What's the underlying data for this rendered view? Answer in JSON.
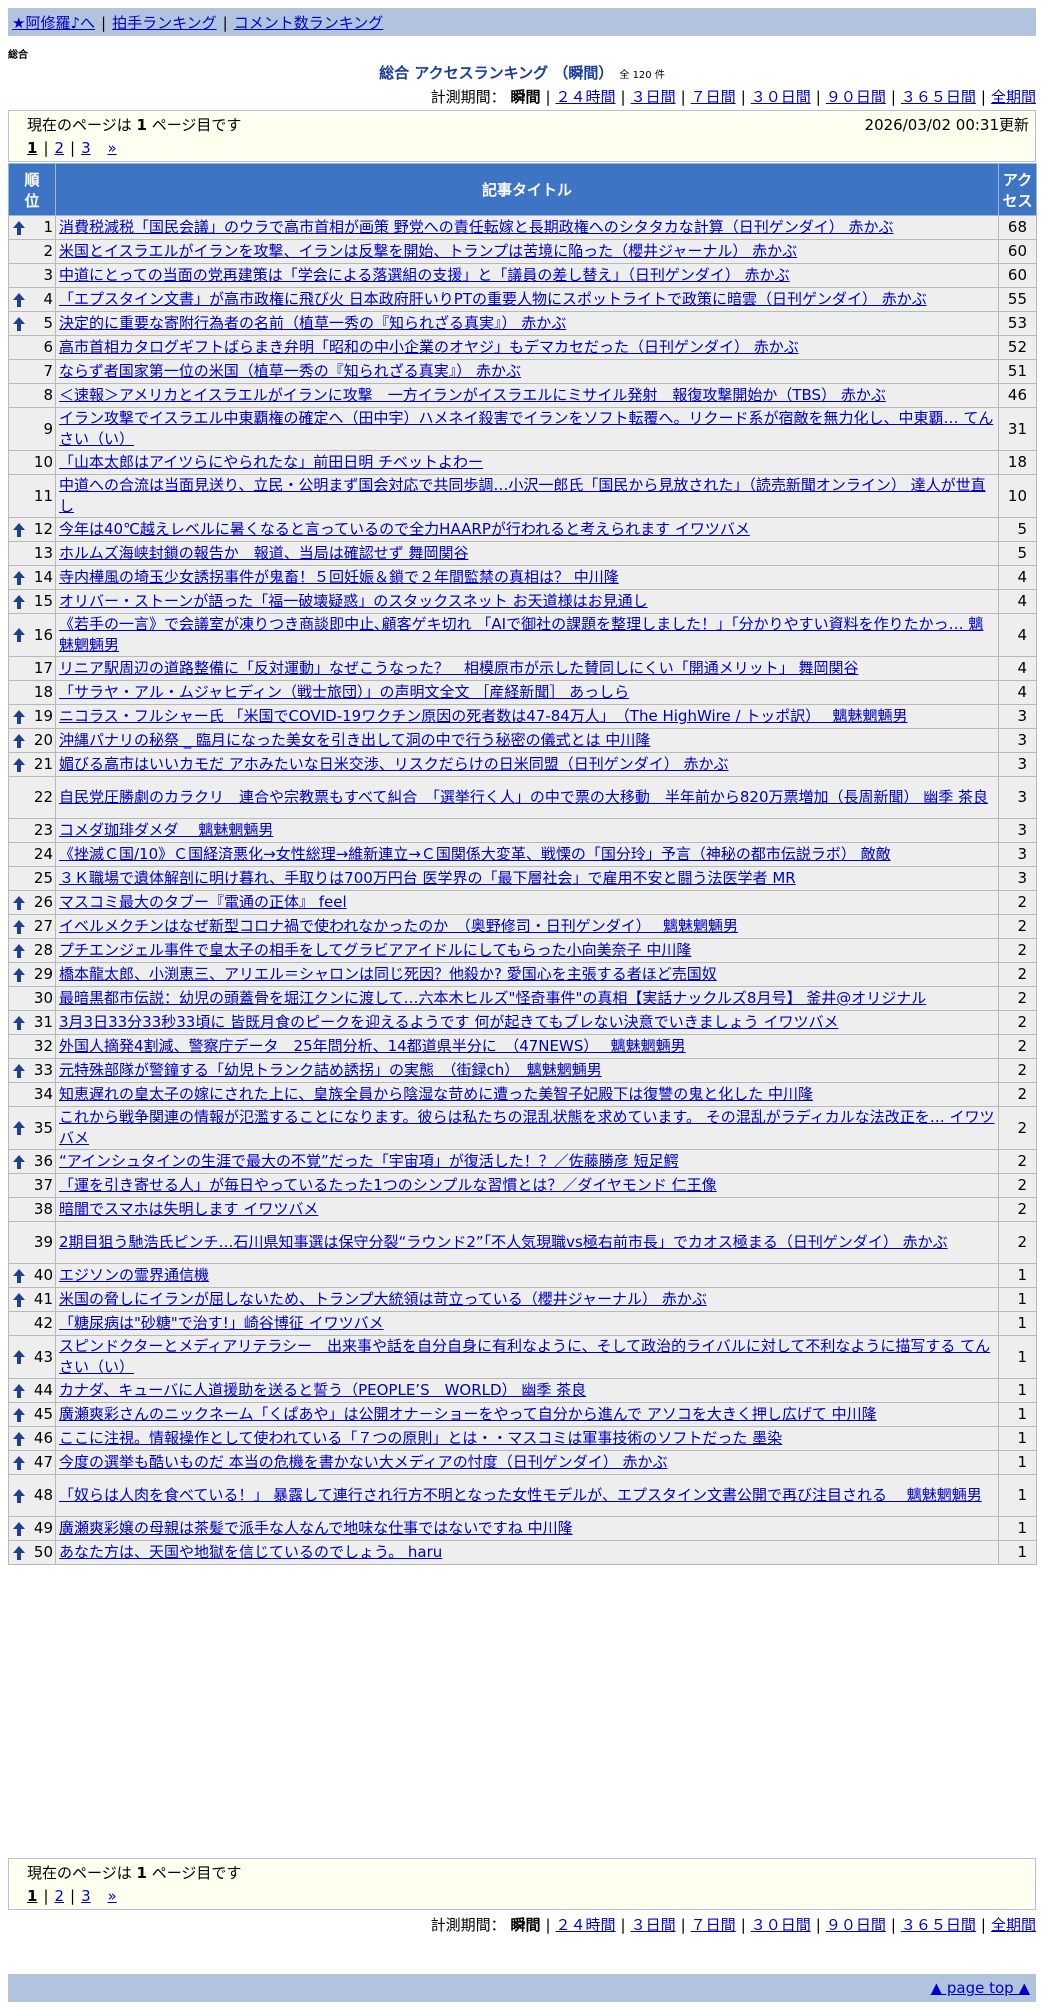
{
  "topnav": {
    "items": [
      "★阿修羅♪へ",
      "拍手ランキング",
      "コメント数ランキング"
    ]
  },
  "section_label": "総合",
  "title": "総合 アクセスランキング （瞬間）",
  "total_count": "全 120 件",
  "period": {
    "label": "計測期間：",
    "current": "瞬間",
    "links": [
      "２４時間",
      "３日間",
      "７日間",
      "３０日間",
      "９０日間",
      "３６５日間",
      "全期間"
    ]
  },
  "pageinfo": {
    "text_before": "現在のページは ",
    "current": "1",
    "text_after": " ページ目です",
    "updated": "2026/03/02 00:31更新",
    "pages": [
      "1",
      "2",
      "3",
      "»"
    ]
  },
  "table": {
    "col_rank": [
      "順",
      "位"
    ],
    "col_title": "記事タイトル",
    "col_access": [
      "アク",
      "セス"
    ],
    "rows": [
      {
        "rank": "1",
        "up": true,
        "title": "消費税減税「国民会議」のウラで高市首相が画策 野党への責任転嫁と長期政権へのシタタカな計算（日刊ゲンダイ） 赤かぶ",
        "access": "68"
      },
      {
        "rank": "2",
        "up": false,
        "title": "米国とイスラエルがイランを攻撃、イランは反撃を開始、トランプは苦境に陥った（櫻井ジャーナル） 赤かぶ",
        "access": "60"
      },
      {
        "rank": "3",
        "up": false,
        "title": "中道にとっての当面の党再建策は「学会による落選組の支援」と「議員の差し替え」（日刊ゲンダイ） 赤かぶ",
        "access": "60"
      },
      {
        "rank": "4",
        "up": true,
        "title": "「エプスタイン文書」が高市政権に飛び火 日本政府肝いりPTの重要人物にスポットライトで政策に暗雲（日刊ゲンダイ） 赤かぶ",
        "access": "55"
      },
      {
        "rank": "5",
        "up": true,
        "title": "決定的に重要な寄附行為者の名前（植草一秀の『知られざる真実』） 赤かぶ",
        "access": "53"
      },
      {
        "rank": "6",
        "up": false,
        "title": "高市首相カタログギフトばらまき弁明「昭和の中小企業のオヤジ」もデマカセだった（日刊ゲンダイ） 赤かぶ",
        "access": "52"
      },
      {
        "rank": "7",
        "up": false,
        "title": "ならず者国家第一位の米国（植草一秀の『知られざる真実』） 赤かぶ",
        "access": "51"
      },
      {
        "rank": "8",
        "up": false,
        "title": "＜速報＞アメリカとイスラエルがイランに攻撃　一方イランがイスラエルにミサイル発射　報復攻撃開始か（TBS） 赤かぶ",
        "access": "46"
      },
      {
        "rank": "9",
        "up": false,
        "title": "イラン攻撃でイスラエル中東覇権の確定へ（田中宇）ハメネイ殺害でイランをソフト転覆へ。リクード系が宿敵を無力化し、中東覇… てんさい（い）",
        "access": "31"
      },
      {
        "rank": "10",
        "up": false,
        "title": "「山本太郎はアイツらにやられたな」前田日明 チベットよわー",
        "access": "18"
      },
      {
        "rank": "11",
        "up": false,
        "title": "中道への合流は当面見送り、立民・公明まず国会対応で共同歩調…小沢一郎氏「国民から見放された」（読売新聞オンライン） 達人が世直し",
        "access": "10"
      },
      {
        "rank": "12",
        "up": true,
        "title": "今年は40℃越えレベルに暑くなると言っているので全力HAARPが行われると考えられます イワツバメ",
        "access": "5"
      },
      {
        "rank": "13",
        "up": false,
        "title": "ホルムズ海峡封鎖の報告か　報道、当局は確認せず 舞岡関谷",
        "access": "5"
      },
      {
        "rank": "14",
        "up": true,
        "title": "寺内樺風の埼玉少女誘拐事件が鬼畜！５回妊娠＆鎖で２年間監禁の真相は？ 中川隆",
        "access": "4"
      },
      {
        "rank": "15",
        "up": true,
        "title": "オリバー・ストーンが語った「福一破壊疑惑」のスタックスネット お天道様はお見通し",
        "access": "4"
      },
      {
        "rank": "16",
        "up": true,
        "title": "《若手の一言》で会議室が凍りつき商談即中止､顧客ゲキ切れ 「AIで御社の課題を整理しました！」「分かりやすい資料を作りたかっ… 魑魅魍魎男",
        "access": "4"
      },
      {
        "rank": "17",
        "up": false,
        "title": "リニア駅周辺の道路整備に「反対運動」なぜこうなった？　相模原市が示した賛同しにくい「開通メリット」 舞岡関谷",
        "access": "4"
      },
      {
        "rank": "18",
        "up": false,
        "title": "「サラヤ・アル・ムジャヒディン（戦士旅団）」の声明文全文 ［産経新聞］ あっしら",
        "access": "4"
      },
      {
        "rank": "19",
        "up": true,
        "title": "ニコラス・フルシャー氏 「米国でCOVID-19ワクチン原因の死者数は47-84万人」　（The HighWire / トッポ訳）　 魑魅魍魎男",
        "access": "3"
      },
      {
        "rank": "20",
        "up": true,
        "title": "沖縄パナリの秘祭 _ 臨月になった美女を引き出して洞の中で行う秘密の儀式とは 中川隆",
        "access": "3"
      },
      {
        "rank": "21",
        "up": true,
        "title": "媚びる高市はいいカモだ アホみたいな日米交渉、リスクだらけの日米同盟（日刊ゲンダイ） 赤かぶ",
        "access": "3"
      },
      {
        "rank": "22",
        "up": false,
        "title": "自民党圧勝劇のカラクリ　連合や宗教票もすべて糾合　「選挙行く人」の中で票の大移動　半年前から820万票増加（長周新聞） 幽季 茶良",
        "access": "3"
      },
      {
        "rank": "23",
        "up": false,
        "title": "コメダ珈琲ダメダ 　魑魅魍魎男",
        "access": "3"
      },
      {
        "rank": "24",
        "up": false,
        "title": "《挫滅Ｃ国/10》Ｃ国経済悪化→女性総理→維新連立→Ｃ国関係大変革、戦慄の「国分玲」予言（神秘の都市伝説ラボ） 敵敵",
        "access": "3"
      },
      {
        "rank": "25",
        "up": false,
        "title": "３Ｋ職場で遺体解剖に明け暮れ、手取りは700万円台 医学界の「最下層社会」で雇用不安と闘う法医学者 MR",
        "access": "3"
      },
      {
        "rank": "26",
        "up": true,
        "title": "マスコミ最大のタブー『電通の正体』 feel",
        "access": "2"
      },
      {
        "rank": "27",
        "up": true,
        "title": "イベルメクチンはなぜ新型コロナ禍で使われなかったのか　（奥野修司・日刊ゲンダイ）　 魑魅魍魎男",
        "access": "2"
      },
      {
        "rank": "28",
        "up": true,
        "title": "プチエンジェル事件で皇太子の相手をしてグラビアアイドルにしてもらった小向美奈子 中川隆",
        "access": "2"
      },
      {
        "rank": "29",
        "up": true,
        "title": "橋本龍太郎、小渕恵三、アリエル＝シャロンは同じ死因？他殺か? 愛国心を主張する者ほど売国奴",
        "access": "2"
      },
      {
        "rank": "30",
        "up": false,
        "title": "最暗黒都市伝説：幼児の頭蓋骨を堀江クンに渡して…六本木ヒルズ\"怪奇事件\"の真相【実話ナックルズ8月号】 釜井@オリジナル",
        "access": "2"
      },
      {
        "rank": "31",
        "up": true,
        "title": "3月3日33分33秒33頃に 皆既月食のピークを迎えるようです 何が起きてもブレない決意でいきましょう イワツバメ",
        "access": "2"
      },
      {
        "rank": "32",
        "up": false,
        "title": "外国人摘発4割減、警察庁データ　25年問分析、14都道県半分に　（47NEWS）　 魑魅魍魎男",
        "access": "2"
      },
      {
        "rank": "33",
        "up": true,
        "title": "元特殊部隊が警鐘する「幼児トランク詰め誘拐」の実態　（街録ch）　魑魅魍魎男",
        "access": "2"
      },
      {
        "rank": "34",
        "up": false,
        "title": "知恵遅れの皇太子の嫁にされた上に、皇族全員から陰湿な苛めに遭った美智子妃殿下は復讐の鬼と化した 中川隆",
        "access": "2"
      },
      {
        "rank": "35",
        "up": true,
        "title": "これから戦争関連の情報が氾濫することになります。彼らは私たちの混乱状態を求めています。 その混乱がラディカルな法改正を… イワツバメ",
        "access": "2"
      },
      {
        "rank": "36",
        "up": true,
        "title": "“アインシュタインの生涯で最大の不覚”だった「宇宙項」が復活した！？／佐藤勝彦 短足鰐",
        "access": "2"
      },
      {
        "rank": "37",
        "up": false,
        "title": "「運を引き寄せる人」が毎日やっているたった1つのシンプルな習慣とは？／ダイヤモンド 仁王像",
        "access": "2"
      },
      {
        "rank": "38",
        "up": false,
        "title": "暗闇でスマホは失明します イワツバメ",
        "access": "2"
      },
      {
        "rank": "39",
        "up": false,
        "title": "2期目狙う馳浩氏ピンチ…石川県知事選は保守分裂“ラウンド2”「不人気現職vs極右前市長」でカオス極まる（日刊ゲンダイ） 赤かぶ",
        "access": "2"
      },
      {
        "rank": "40",
        "up": true,
        "title": "エジソンの霊界通信機",
        "access": "1"
      },
      {
        "rank": "41",
        "up": true,
        "title": "米国の脅しにイランが屈しないため、トランプ大統領は苛立っている（櫻井ジャーナル） 赤かぶ",
        "access": "1"
      },
      {
        "rank": "42",
        "up": false,
        "title": "「糖尿病は\"砂糖\"で治す!」崎谷博征 イワツバメ",
        "access": "1"
      },
      {
        "rank": "43",
        "up": true,
        "title": "スピンドクターとメディアリテラシー　出来事や話を自分自身に有利なように、そして政治的ライバルに対して不利なように描写する てんさい（い）",
        "access": "1"
      },
      {
        "rank": "44",
        "up": true,
        "title": "カナダ、キューバに人道援助を送ると誓う（PEOPLE’S　WORLD） 幽季 茶良",
        "access": "1"
      },
      {
        "rank": "45",
        "up": true,
        "title": "廣瀬爽彩さんのニックネーム「くぱあや」は公開オナ－ショーをやって自分から進んで アソコを大きく押し広げて 中川隆",
        "access": "1"
      },
      {
        "rank": "46",
        "up": true,
        "title": "ここに注視。情報操作として使われている「７つの原則」とは・・マスコミは軍事技術のソフトだった 墨染",
        "access": "1"
      },
      {
        "rank": "47",
        "up": true,
        "title": "今度の選挙も酷いものだ 本当の危機を書かない大メディアの忖度（日刊ゲンダイ） 赤かぶ",
        "access": "1"
      },
      {
        "rank": "48",
        "up": true,
        "title": "「奴らは人肉を食べている！」 暴露して連行され行方不明となった女性モデルが、エプスタイン文書公開で再び注目される　 魑魅魍魎男",
        "access": "1"
      },
      {
        "rank": "49",
        "up": true,
        "title": "廣瀬爽彩嬢の母親は茶髪で派手な人なんで地味な仕事ではないですね 中川隆",
        "access": "1"
      },
      {
        "rank": "50",
        "up": true,
        "title": "あなた方は、天国や地獄を信じているのでしょう。 haru",
        "access": "1"
      }
    ]
  },
  "footer": {
    "page_top": "▲ page top ▲"
  },
  "colors": {
    "nav_bg": "#b2c3dd",
    "header_bg": "#3e74c4",
    "title_color": "#1a3c9e",
    "link": "#0000cc",
    "row_bg": "#eeeeee",
    "pagebox_bg": "#fffff0"
  }
}
